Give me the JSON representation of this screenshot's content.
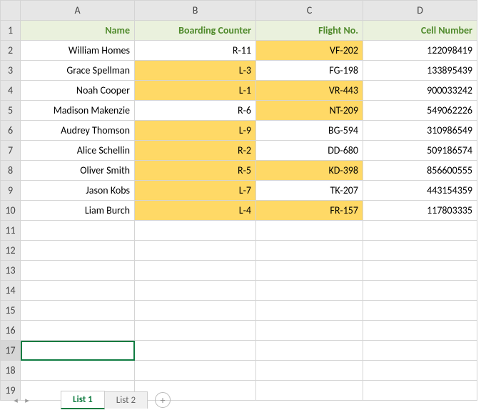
{
  "column_letters": [
    "A",
    "B",
    "C",
    "D"
  ],
  "row_numbers": [
    "1",
    "2",
    "3",
    "4",
    "5",
    "6",
    "7",
    "8",
    "9",
    "10",
    "11",
    "12",
    "13",
    "14",
    "15",
    "16",
    "17",
    "18",
    "19"
  ],
  "selected_row": "17",
  "headers": {
    "name": "Name",
    "counter": "Boarding Counter",
    "flight": "Flight No.",
    "cell": "Cell Number"
  },
  "data": [
    {
      "name": "William Homes",
      "counter": "R-11",
      "flight": "VF-202",
      "cell": "122098419",
      "hl": {
        "counter": false,
        "flight": true
      }
    },
    {
      "name": "Grace Spellman",
      "counter": "L-3",
      "flight": "FG-198",
      "cell": "133895439",
      "hl": {
        "counter": true,
        "flight": false
      }
    },
    {
      "name": "Noah Cooper",
      "counter": "L-1",
      "flight": "VR-443",
      "cell": "900033242",
      "hl": {
        "counter": true,
        "flight": true
      }
    },
    {
      "name": "Madison Makenzie",
      "counter": "R-6",
      "flight": "NT-209",
      "cell": "549062226",
      "hl": {
        "counter": false,
        "flight": true
      }
    },
    {
      "name": "Audrey Thomson",
      "counter": "L-9",
      "flight": "BG-594",
      "cell": "310986549",
      "hl": {
        "counter": true,
        "flight": false
      }
    },
    {
      "name": "Alice Schellin",
      "counter": "R-2",
      "flight": "DD-680",
      "cell": "509186574",
      "hl": {
        "counter": true,
        "flight": false
      }
    },
    {
      "name": "Oliver Smith",
      "counter": "R-5",
      "flight": "KD-398",
      "cell": "856600555",
      "hl": {
        "counter": true,
        "flight": true
      }
    },
    {
      "name": "Jason Kobs",
      "counter": "L-7",
      "flight": "TK-207",
      "cell": "443154359",
      "hl": {
        "counter": true,
        "flight": false
      }
    },
    {
      "name": "Liam Burch",
      "counter": "L-4",
      "flight": "FR-157",
      "cell": "117803335",
      "hl": {
        "counter": true,
        "flight": true
      }
    }
  ],
  "tabs": {
    "active": "List 1",
    "inactive": "List 2"
  },
  "icons": {
    "nav_prev": "◂",
    "nav_next": "▸",
    "add": "+"
  }
}
